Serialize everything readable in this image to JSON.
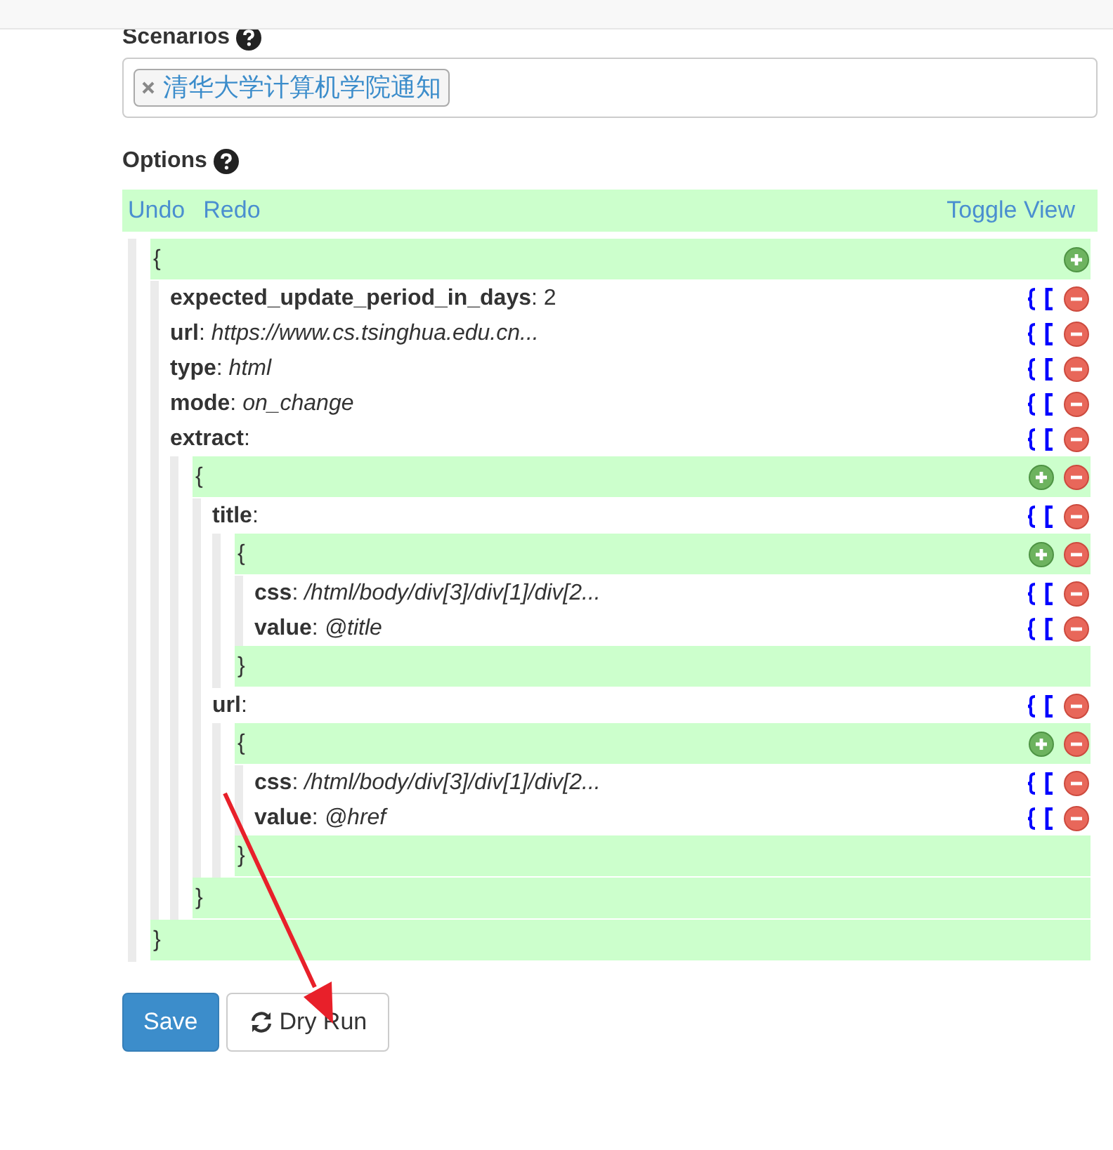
{
  "scenarios": {
    "label": "Scenarios",
    "tags": [
      {
        "text": "清华大学计算机学院通知"
      }
    ]
  },
  "options": {
    "label": "Options",
    "toolbar": {
      "undo": "Undo",
      "redo": "Redo",
      "toggle": "Toggle View"
    },
    "tree": {
      "open": "{",
      "close": "}",
      "removable": false,
      "fields": [
        {
          "text": "**expected_update_period_in_days**: 2"
        },
        {
          "text": "**url**: *https://www.cs.tsinghua.edu.cn...*"
        },
        {
          "text": "**type**: *html*"
        },
        {
          "text": "**mode**: *on_change*"
        },
        {
          "text": "**extract**:",
          "object": {
            "open": "{",
            "close": "}",
            "removable": true,
            "fields": [
              {
                "text": "**title**:",
                "object": {
                  "open": "{",
                  "close": "}",
                  "removable": true,
                  "fields": [
                    {
                      "text": "**css**: */html/body/div[3]/div[1]/div[2...*"
                    },
                    {
                      "text": "**value**: *@title*"
                    }
                  ]
                }
              },
              {
                "text": "**url**:",
                "object": {
                  "open": "{",
                  "close": "}",
                  "removable": true,
                  "fields": [
                    {
                      "text": "**css**: */html/body/div[3]/div[1]/div[2...*"
                    },
                    {
                      "text": "**value**: *@href*"
                    }
                  ]
                }
              }
            ]
          }
        }
      ]
    }
  },
  "buttons": [
    {
      "kind": "primary",
      "label": "Save"
    },
    {
      "kind": "default",
      "label": "Dry Run"
    }
  ]
}
